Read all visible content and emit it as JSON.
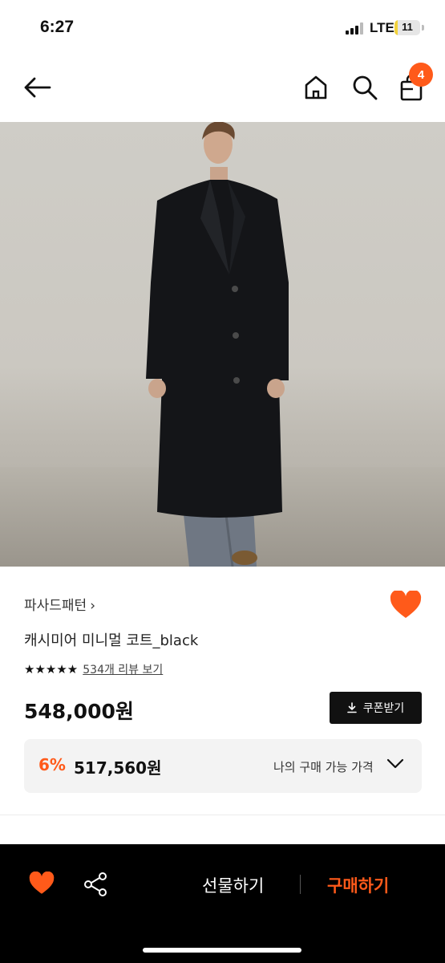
{
  "status_bar": {
    "time": "6:27",
    "network": "LTE",
    "battery": "11",
    "battery_level": 0.11
  },
  "nav": {
    "cart_count": "4"
  },
  "product": {
    "brand": "파사드패턴",
    "brand_chevron": "›",
    "title": "캐시미어 미니멀 코트_black",
    "stars": "★★★★★",
    "review_link": "534개 리뷰 보기",
    "price": "548,000원",
    "coupon_button": "쿠폰받기",
    "member": {
      "discount": "6%",
      "price": "517,560원",
      "label": "나의 구매 가능 가격"
    }
  },
  "bottom_bar": {
    "gift_label": "선물하기",
    "buy_label": "구매하기"
  },
  "colors": {
    "accent": "#ff5a1a",
    "dark": "#111111"
  },
  "icons": [
    "back-arrow-icon",
    "home-icon",
    "search-icon",
    "bag-icon",
    "heart-icon",
    "share-icon",
    "download-icon",
    "chevron-down-icon"
  ]
}
